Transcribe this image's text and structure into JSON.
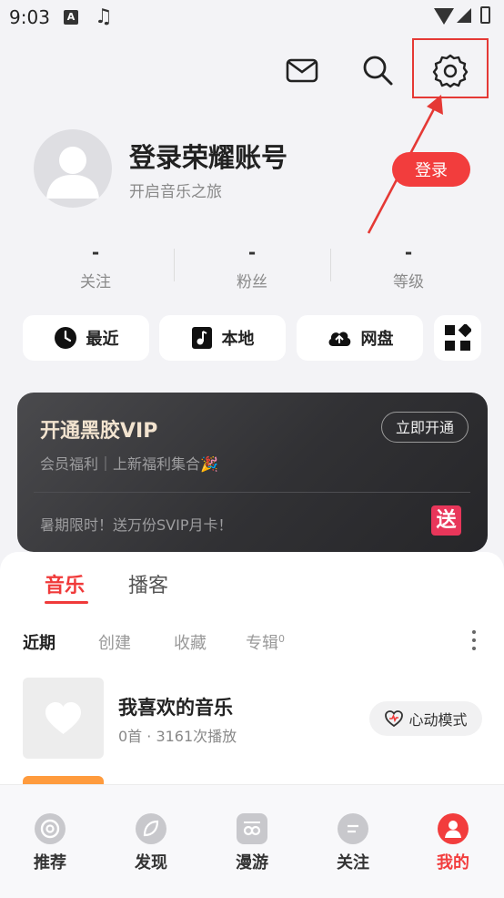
{
  "status_bar": {
    "time": "9:03",
    "keyboard_icon": "A",
    "music_icon": "music-note"
  },
  "top_bar": {
    "icons": [
      "mail-icon",
      "search-icon",
      "settings-icon"
    ]
  },
  "profile": {
    "title": "登录荣耀账号",
    "subtitle": "开启音乐之旅",
    "login_label": "登录"
  },
  "stats": [
    {
      "value": "-",
      "label": "关注"
    },
    {
      "value": "-",
      "label": "粉丝"
    },
    {
      "value": "-",
      "label": "等级"
    }
  ],
  "quick": {
    "recent": "最近",
    "local": "本地",
    "cloud": "网盘"
  },
  "vip": {
    "title": "开通黑胶VIP",
    "button": "立即开通",
    "subtitle": "会员福利｜上新福利集合🎉",
    "promo": "暑期限时！送万份SVIP月卡！",
    "badge": "送"
  },
  "content_tabs": {
    "music": "音乐",
    "podcast": "播客"
  },
  "subtabs": {
    "recent": "近期",
    "created": "创建",
    "favorites": "收藏",
    "albums": "专辑",
    "albums_count": "0"
  },
  "playlist": {
    "title": "我喜欢的音乐",
    "meta": "0首 · 3161次播放",
    "heartbeat_label": "心动模式"
  },
  "nav": [
    {
      "label": "推荐",
      "icon": "recommend-icon"
    },
    {
      "label": "发现",
      "icon": "discover-icon"
    },
    {
      "label": "漫游",
      "icon": "roam-icon"
    },
    {
      "label": "关注",
      "icon": "follow-icon"
    },
    {
      "label": "我的",
      "icon": "profile-icon",
      "active": true
    }
  ],
  "colors": {
    "accent": "#f23d3d",
    "annotation": "#e53935",
    "vip_bg": "#333336",
    "vip_gold": "#f2e3cf"
  }
}
